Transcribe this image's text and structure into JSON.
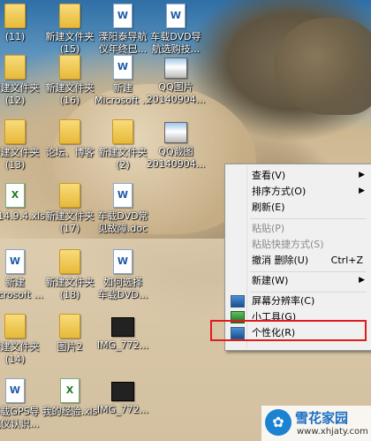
{
  "desktop": {
    "icons": [
      {
        "type": "folder",
        "label": "(11)"
      },
      {
        "type": "folder",
        "label": "新建文件夹\n(15)"
      },
      {
        "type": "doc",
        "label": "溧阳泰导航\n仪年终巳..."
      },
      {
        "type": "doc",
        "label": "车载DVD导\n航选购技..."
      },
      {
        "type": "folder",
        "label": "新建文件夹\n(12)"
      },
      {
        "type": "folder",
        "label": "新建文件夹\n(16)"
      },
      {
        "type": "doc",
        "label": "新建\nMicrosoft ..."
      },
      {
        "type": "pic",
        "label": "QQ图片\n20140904..."
      },
      {
        "type": "folder",
        "label": "新建文件夹\n(13)"
      },
      {
        "type": "folder",
        "label": "论坛、博客"
      },
      {
        "type": "folder",
        "label": "新建文件夹\n(2)"
      },
      {
        "type": "pic",
        "label": "QQ截图\n20140904..."
      },
      {
        "type": "xls",
        "label": "2014.9.4.xls"
      },
      {
        "type": "folder",
        "label": "新建文件夹\n(17)"
      },
      {
        "type": "doc",
        "label": "车载DVD常\n见故障.doc"
      },
      {
        "type": "doc",
        "label": "新建\nMicrosoft ..."
      },
      {
        "type": "folder",
        "label": "新建文件夹\n(18)"
      },
      {
        "type": "doc",
        "label": "如何选择\n车载DVD..."
      },
      {
        "type": "folder",
        "label": "新建文件夹\n(14)"
      },
      {
        "type": "folder",
        "label": "图片2"
      },
      {
        "type": "film",
        "label": "IMG_772..."
      },
      {
        "type": "doc",
        "label": "车载GPS导\n航仪认识..."
      },
      {
        "type": "xls",
        "label": "我的经验.xls"
      },
      {
        "type": "film",
        "label": "IMG_772..."
      }
    ]
  },
  "context_menu": {
    "view": "查看(V)",
    "sort": "排序方式(O)",
    "refresh": "刷新(E)",
    "paste": "粘贴(P)",
    "paste_shortcut": "粘贴快捷方式(S)",
    "undo_delete": "撤消 删除(U)",
    "undo_shortcut": "Ctrl+Z",
    "new": "新建(W)",
    "screen_resolution": "屏幕分辨率(C)",
    "gadgets": "小工具(G)",
    "personalize": "个性化(R)"
  },
  "watermark": {
    "logo_glyph": "✿",
    "title": "雪花家园",
    "url": "www.xhjaty.com"
  },
  "colors": {
    "highlight_border": "#e11b1b",
    "menu_bg": "#f0f0f0"
  }
}
